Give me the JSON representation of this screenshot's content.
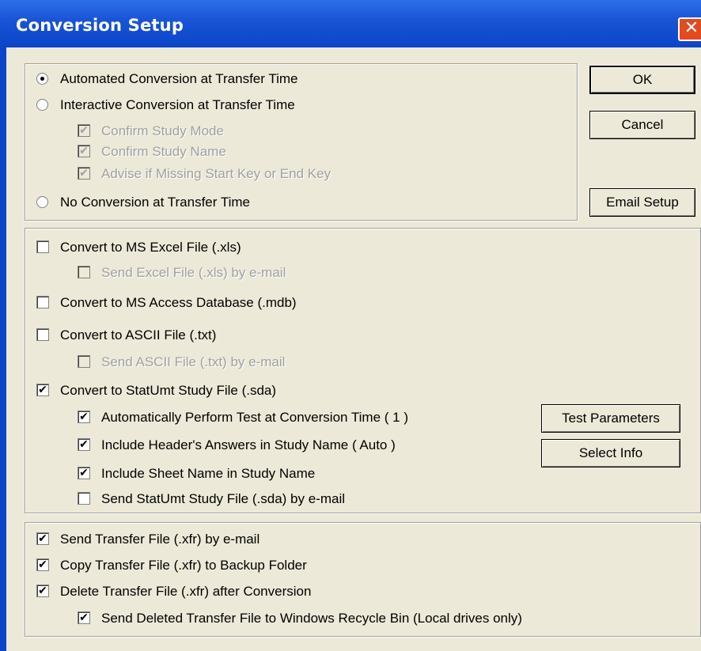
{
  "window": {
    "title": "Conversion Setup",
    "close_glyph": "✕"
  },
  "mode": {
    "automated": "Automated Conversion at Transfer Time",
    "interactive": "Interactive Conversion at Transfer Time",
    "confirm_mode": "Confirm Study Mode",
    "confirm_name": "Confirm Study Name",
    "advise_missing": "Advise if Missing Start Key or End Key",
    "none": "No Conversion at Transfer Time",
    "selected": "automated"
  },
  "buttons": {
    "ok": "OK",
    "cancel": "Cancel",
    "email_setup": "Email Setup",
    "test_parameters": "Test Parameters",
    "select_info": "Select Info"
  },
  "convert": {
    "excel": "Convert to MS Excel File (.xls)",
    "excel_email": "Send Excel File (.xls) by e-mail",
    "access": "Convert to MS Access Database (.mdb)",
    "ascii": "Convert to ASCII File (.txt)",
    "ascii_email": "Send ASCII File (.txt) by e-mail",
    "statumt": "Convert to StatUmt Study File (.sda)",
    "auto_test": "Automatically Perform Test at Conversion Time ( 1 )",
    "header_answers": "Include Header's Answers in Study Name ( Auto )",
    "sheet_name": "Include Sheet Name in Study Name",
    "statumt_email": "Send StatUmt Study File (.sda) by e-mail"
  },
  "transfer": {
    "send_email": "Send Transfer File (.xfr) by e-mail",
    "copy_backup": "Copy Transfer File (.xfr) to Backup Folder",
    "delete_after": "Delete Transfer File (.xfr) after Conversion",
    "recycle_bin": "Send Deleted Transfer File to Windows Recycle Bin (Local drives only)"
  },
  "check_glyph": "✔"
}
